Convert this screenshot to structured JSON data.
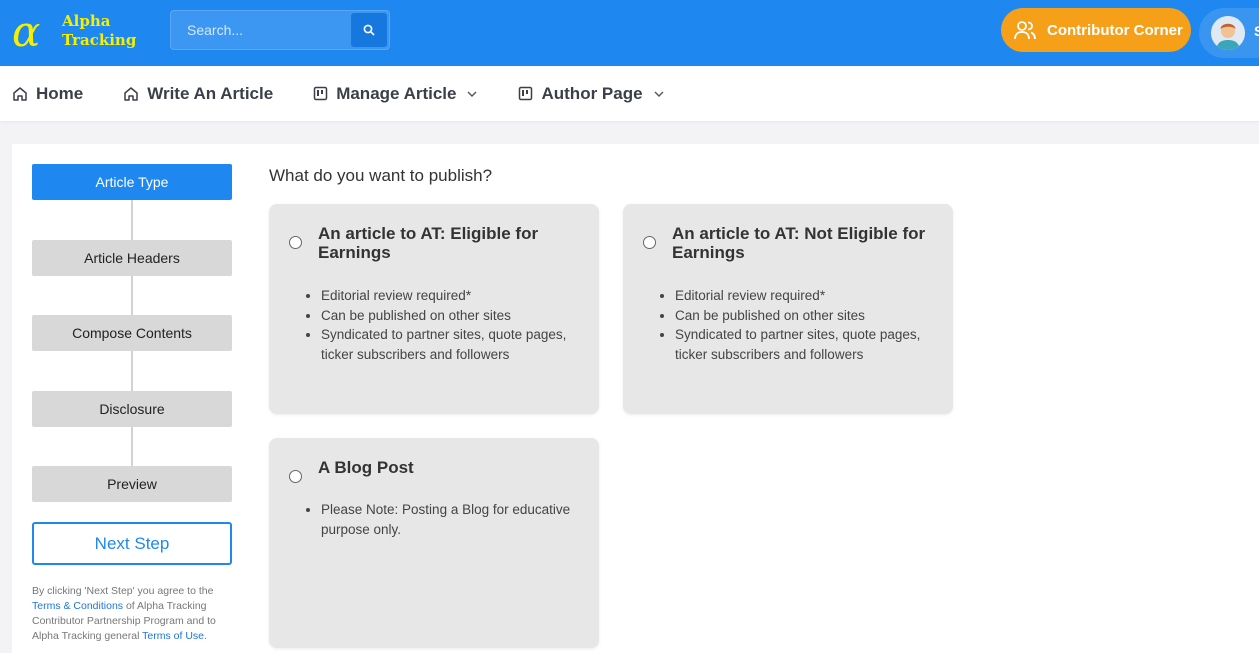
{
  "header": {
    "logo_symbol": "α",
    "logo_line1": "Alpha",
    "logo_line2": "Tracking",
    "search_placeholder": "Search...",
    "contributor_label": "Contributor Corner",
    "avatar_initial": "S"
  },
  "nav": {
    "items": [
      {
        "label": "Home"
      },
      {
        "label": "Write An Article"
      },
      {
        "label": "Manage Article"
      },
      {
        "label": "Author Page"
      }
    ]
  },
  "steps": {
    "items": [
      {
        "label": "Article Type",
        "active": true
      },
      {
        "label": "Article Headers"
      },
      {
        "label": "Compose Contents"
      },
      {
        "label": "Disclosure"
      },
      {
        "label": "Preview"
      }
    ],
    "next_label": "Next Step"
  },
  "terms": {
    "part1": "By clicking 'Next Step' you agree to the ",
    "link1": "Terms & Conditions",
    "part2": " of Alpha Tracking Contributor Partnership Program and to Alpha Tracking general ",
    "link2": "Terms of Use",
    "part3": "."
  },
  "main": {
    "question": "What do you want to publish?",
    "options": [
      {
        "title": "An article to AT: Eligible for Earnings",
        "bullets": [
          "Editorial review required*",
          "Can be published on other sites",
          "Syndicated to partner sites, quote pages, ticker subscribers and followers"
        ]
      },
      {
        "title": "An article to AT: Not Eligible for Earnings",
        "bullets": [
          "Editorial review required*",
          "Can be published on other sites",
          "Syndicated to partner sites, quote pages, ticker subscribers and followers"
        ]
      },
      {
        "title": "A Blog Post",
        "bullets": [
          "Please Note: Posting a Blog for educative purpose only."
        ]
      }
    ]
  },
  "colors": {
    "primary": "#1e88f0",
    "accent_orange": "#f6a019",
    "logo_yellow": "#f5f000",
    "card_bg": "#e7e7e7"
  },
  "icons": {
    "search": "search-icon",
    "contributor": "users-icon",
    "home": "home-icon",
    "manage": "board-icon",
    "chevron": "chevron-down-icon"
  }
}
